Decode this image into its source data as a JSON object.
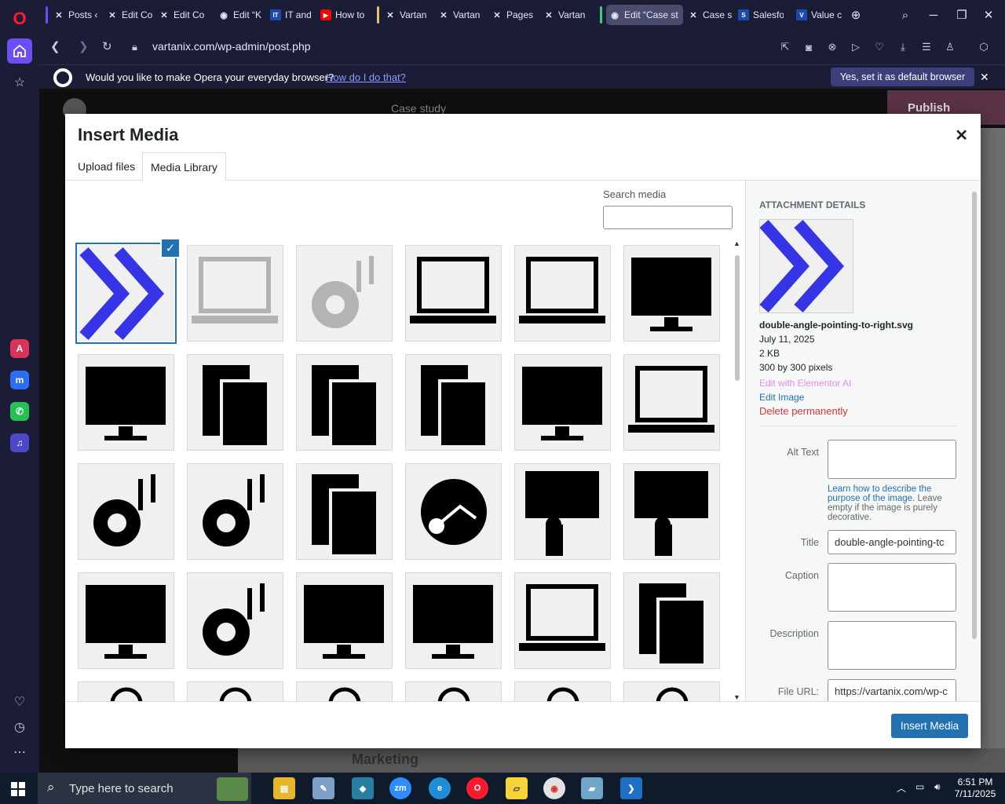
{
  "browser": {
    "tabs": [
      {
        "label": "Posts ‹",
        "fav": "V"
      },
      {
        "label": "Edit Co",
        "fav": "V"
      },
      {
        "label": "Edit Co",
        "fav": "V"
      },
      {
        "label": "Edit “K",
        "fav": "W"
      },
      {
        "label": "IT and",
        "fav": "IT"
      },
      {
        "label": "How to",
        "fav": "▶"
      },
      {
        "label": "Vartan",
        "fav": "V"
      },
      {
        "label": "Vartan",
        "fav": "V"
      },
      {
        "label": "Pages",
        "fav": "V"
      },
      {
        "label": "Vartan",
        "fav": "V"
      },
      {
        "label": "Edit “Case st",
        "fav": "W"
      },
      {
        "label": "Case st",
        "fav": "V"
      },
      {
        "label": "Salesfo",
        "fav": "S"
      },
      {
        "label": "Value c",
        "fav": "V"
      }
    ],
    "url": "vartanix.com/wp-admin/post.php",
    "infobar": {
      "message": "Would you like to make Opera your everyday browser?",
      "link": "How do I do that?",
      "button": "Yes, set it as default browser"
    }
  },
  "editor_bg": {
    "page_label": "Case study",
    "publish": "Publish",
    "footer_text": "Marketing"
  },
  "modal": {
    "title": "Insert Media",
    "tabs": [
      "Upload files",
      "Media Library"
    ],
    "active_tab": "Media Library",
    "search_label": "Search media",
    "search_value": "",
    "grid_icons": [
      "double-angle-right",
      "money-laptop-faded",
      "gear-warning-faded",
      "money-hook-laptop",
      "laptop-sync-icon",
      "monitor-roadmap",
      "monitor-money-chart",
      "documents-speed",
      "password-shield",
      "password-shield-2",
      "dashboard-flowchart",
      "laptop-code-search",
      "cloud-idea",
      "chess-eye-analytics",
      "briefcase-search",
      "money-network-circle",
      "hand-rating-stars",
      "hand-rating-stars-2",
      "dollar-growth-chart",
      "gears-growth-clock",
      "wrench-settings-window",
      "rocket-monitor",
      "rocket-laptop",
      "box-pencil-tablet",
      "partial-1",
      "partial-2",
      "partial-3",
      "partial-4",
      "partial-5",
      "partial-6"
    ],
    "selected_index": 0,
    "details": {
      "heading": "ATTACHMENT DETAILS",
      "filename": "double-angle-pointing-to-right.svg",
      "date": "July 11, 2025",
      "size": "2 KB",
      "dimensions": "300 by 300 pixels",
      "elementor_ai": "Edit with Elementor AI",
      "edit_image": "Edit Image",
      "delete": "Delete permanently",
      "alt_label": "Alt Text",
      "alt_value": "",
      "alt_help_link": "Learn how to describe the purpose of the image.",
      "alt_help_rest": " Leave empty if the image is purely decorative.",
      "title_label": "Title",
      "title_value": "double-angle-pointing-tc",
      "caption_label": "Caption",
      "caption_value": "",
      "description_label": "Description",
      "description_value": "",
      "url_label": "File URL:",
      "url_value": "https://vartanix.com/wp-c"
    },
    "insert_button": "Insert Media",
    "accent_color": "#2271b1",
    "selection_color": "#3534e6"
  },
  "taskbar": {
    "search_placeholder": "Type here to search",
    "time": "6:51 PM",
    "date": "7/11/2025"
  }
}
